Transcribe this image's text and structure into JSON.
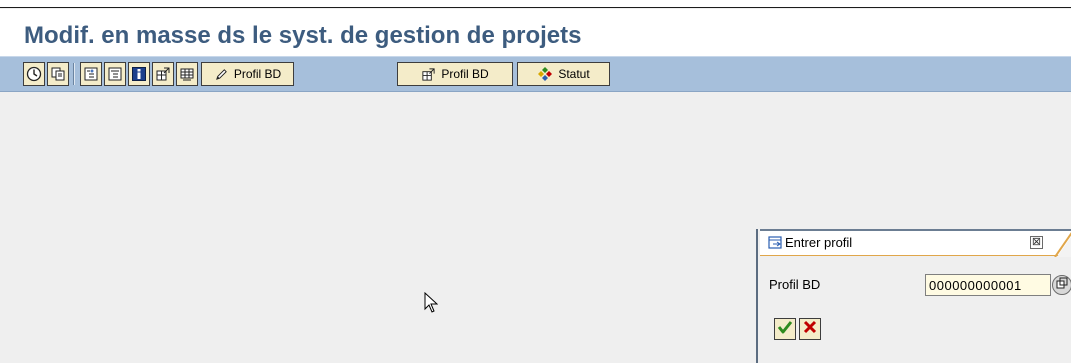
{
  "window": {
    "title": "Modif. en masse ds le syst. de gestion de projets"
  },
  "toolbar": {
    "buttons": [
      {
        "icon": "execute-clock-icon"
      },
      {
        "icon": "copy-icon"
      },
      {
        "icon": "expand-icon"
      },
      {
        "icon": "collapse-icon"
      },
      {
        "icon": "info-icon"
      },
      {
        "icon": "export-icon"
      },
      {
        "icon": "table-icon"
      },
      {
        "icon": "pencil-icon",
        "label": "Profil BD"
      },
      {
        "icon": "export-icon",
        "label": "Profil BD"
      },
      {
        "icon": "status-icon",
        "label": "Statut"
      }
    ]
  },
  "dialog": {
    "title": "Entrer profil",
    "close_symbol": "⊠",
    "field_label": "Profil BD",
    "field_value": "000000000001"
  },
  "colors": {
    "title": "#3d5c7f",
    "toolbar_bg": "#a6bfdb",
    "button_bg": "#f4ecc9",
    "accept_green": "#2e8b1e",
    "cancel_red": "#c00000"
  }
}
